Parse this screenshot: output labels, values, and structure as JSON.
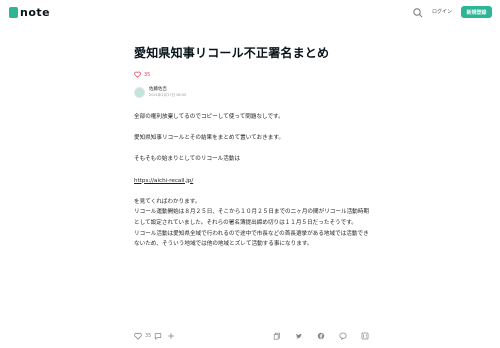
{
  "header": {
    "logo_text": "note",
    "login_label": "ログイン",
    "signup_label": "新規登録"
  },
  "article": {
    "title": "愛知県知事リコール不正署名まとめ",
    "like_count": "35",
    "author_name": "佐藤佐吉",
    "post_date": "2021年2月17日 08:00",
    "paragraphs": [
      "全部の権利放棄してるのでコピーして使って問題なしです。",
      "愛知県知事リコールとその結果をまとめて置いておきます。",
      "そもそもの始まりとしてのリコール活動は",
      "https://aichi-recall.jp/",
      "を見てくればわかります。",
      "リコール運動開始は８月２５日、そこから１０月２５日までの二ヶ月の間がリコール活動時期として設定されていました。それらの署名簿提出締め切りは１１月５日だったそうです。",
      "リコール活動は愛知県全域で行われるので途中で市長などの首長選挙がある地域では活動できないため、そういう地域では他の地域とズレて活動する事になります。"
    ]
  },
  "footer": {
    "like_count": "35",
    "colors": {
      "accent": "#2cb696",
      "like": "#e8455d"
    }
  }
}
